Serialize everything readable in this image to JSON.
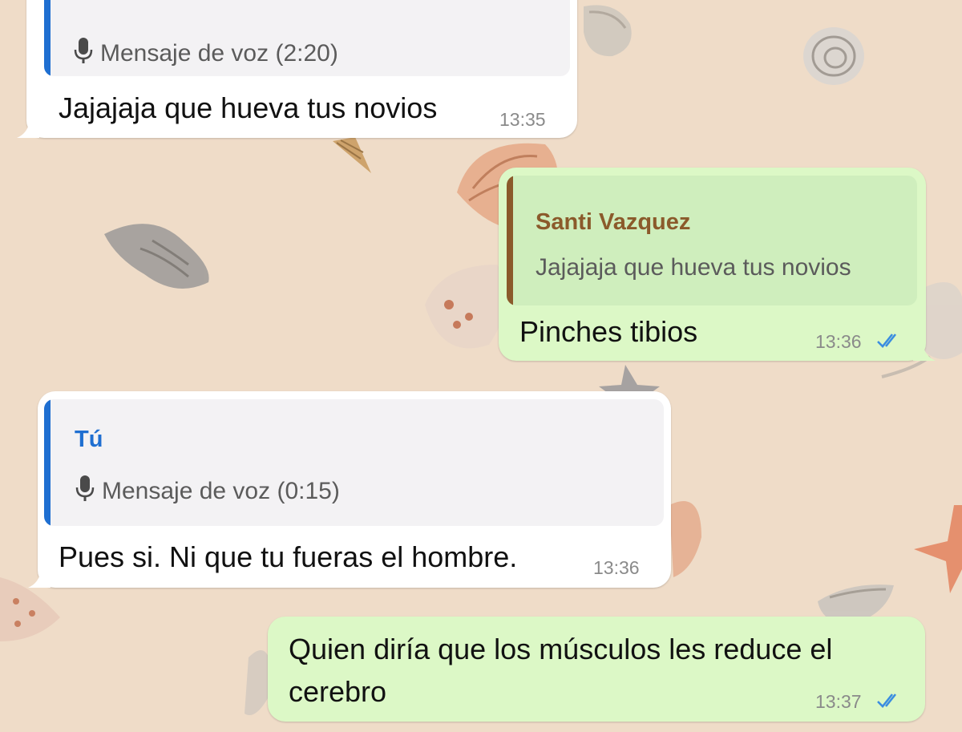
{
  "chat": {
    "messages": [
      {
        "direction": "incoming",
        "quote": {
          "author": "",
          "text": "Mensaje de voz (2:20)",
          "icon": "mic-icon"
        },
        "text": "Jajajaja que hueva tus novios",
        "time": "13:35"
      },
      {
        "direction": "outgoing",
        "quote": {
          "author": "Santi Vazquez",
          "text": "Jajajaja que hueva tus novios"
        },
        "text": "Pinches tibios",
        "time": "13:36",
        "status": "read"
      },
      {
        "direction": "incoming",
        "quote": {
          "author": "Tú",
          "text": "Mensaje de voz (0:15)",
          "icon": "mic-icon"
        },
        "text": "Pues si. Ni que tu fueras el hombre.",
        "time": "13:36"
      },
      {
        "direction": "outgoing",
        "text_lines": [
          "Quien diría que los músculos les reduce el",
          "cerebro"
        ],
        "time": "13:37",
        "status": "read"
      }
    ]
  },
  "colors": {
    "wallpaper": "#efdcc8",
    "incoming_bubble": "#ffffff",
    "outgoing_bubble": "#dcf8c6",
    "quote_bar_incoming": "#1f6fd1",
    "quote_bar_outgoing": "#8b5a2b",
    "author_self": "#1f6fd1",
    "author_other": "#8b5a2b",
    "read_ticks": "#3a8de0"
  }
}
